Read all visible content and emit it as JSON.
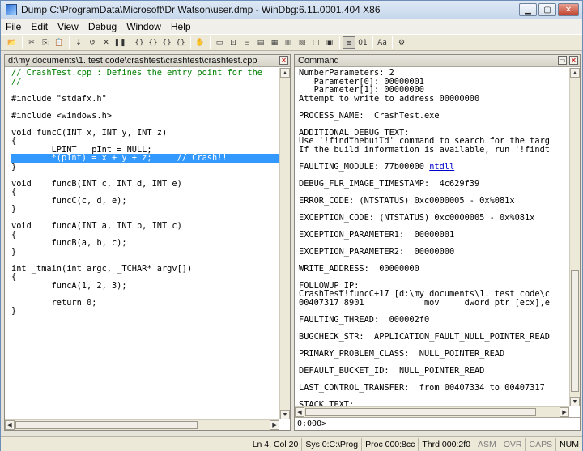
{
  "window": {
    "title": "Dump C:\\ProgramData\\Microsoft\\Dr Watson\\user.dmp - WinDbg:6.11.0001.404 X86"
  },
  "menu": [
    "File",
    "Edit",
    "View",
    "Debug",
    "Window",
    "Help"
  ],
  "toolbar": {
    "buttons": [
      {
        "name": "open-icon",
        "glyph": "📂"
      },
      {
        "sep": true
      },
      {
        "name": "cut-icon",
        "glyph": "✂"
      },
      {
        "name": "copy-icon",
        "glyph": "⎘"
      },
      {
        "name": "paste-icon",
        "glyph": "📋"
      },
      {
        "sep": true
      },
      {
        "name": "go-icon",
        "glyph": "⇣"
      },
      {
        "name": "restart-icon",
        "glyph": "↺"
      },
      {
        "name": "stop-debugging-icon",
        "glyph": "✕"
      },
      {
        "name": "break-icon",
        "glyph": "❚❚"
      },
      {
        "sep": true
      },
      {
        "name": "step-into-icon",
        "glyph": "{}"
      },
      {
        "name": "step-over-icon",
        "glyph": "{}"
      },
      {
        "name": "step-out-icon",
        "glyph": "{}"
      },
      {
        "name": "run-to-cursor-icon",
        "glyph": "{}"
      },
      {
        "sep": true
      },
      {
        "name": "breakpoint-icon",
        "glyph": "✋"
      },
      {
        "sep": true
      },
      {
        "name": "command-window-icon",
        "glyph": "▭"
      },
      {
        "name": "watch-window-icon",
        "glyph": "⊡"
      },
      {
        "name": "locals-window-icon",
        "glyph": "⊟"
      },
      {
        "name": "registers-window-icon",
        "glyph": "▤"
      },
      {
        "name": "memory-window-icon",
        "glyph": "▦"
      },
      {
        "name": "call-stack-window-icon",
        "glyph": "▥"
      },
      {
        "name": "disassembly-window-icon",
        "glyph": "▧"
      },
      {
        "name": "scratch-pad-icon",
        "glyph": "▢"
      },
      {
        "name": "processes-threads-icon",
        "glyph": "▣"
      },
      {
        "sep": true
      },
      {
        "name": "source-mode-icon",
        "glyph": "≣",
        "pressed": true
      },
      {
        "name": "hex-display-icon",
        "glyph": "01"
      },
      {
        "sep": true
      },
      {
        "name": "font-icon",
        "glyph": "Aa"
      },
      {
        "sep": true
      },
      {
        "name": "options-icon",
        "glyph": "⚙"
      }
    ]
  },
  "source_pane": {
    "title": "d:\\my documents\\1. test code\\crashtest\\crashtest\\crashtest.cpp",
    "lines": [
      {
        "text": "// CrashTest.cpp : Defines the entry point for the",
        "kind": "comment"
      },
      {
        "text": "//",
        "kind": "comment"
      },
      {
        "text": "",
        "kind": "plain"
      },
      {
        "text": "#include \"stdafx.h\"",
        "kind": "include-cursor"
      },
      {
        "text": "",
        "kind": "plain"
      },
      {
        "text": "#include <windows.h>",
        "kind": "plain"
      },
      {
        "text": "",
        "kind": "plain"
      },
      {
        "text": "void funcC(INT x, INT y, INT z)",
        "kind": "plain"
      },
      {
        "text": "{",
        "kind": "plain"
      },
      {
        "text": "        LPINT   pInt = NULL;",
        "kind": "plain"
      },
      {
        "text": "        *(pInt) = x + y + z;     // Crash!!",
        "kind": "highlight"
      },
      {
        "text": "}",
        "kind": "plain"
      },
      {
        "text": "",
        "kind": "plain"
      },
      {
        "text": "void    funcB(INT c, INT d, INT e)",
        "kind": "plain"
      },
      {
        "text": "{",
        "kind": "plain"
      },
      {
        "text": "        funcC(c, d, e);",
        "kind": "plain"
      },
      {
        "text": "}",
        "kind": "plain"
      },
      {
        "text": "",
        "kind": "plain"
      },
      {
        "text": "void    funcA(INT a, INT b, INT c)",
        "kind": "plain"
      },
      {
        "text": "{",
        "kind": "plain"
      },
      {
        "text": "        funcB(a, b, c);",
        "kind": "plain"
      },
      {
        "text": "}",
        "kind": "plain"
      },
      {
        "text": "",
        "kind": "plain"
      },
      {
        "text": "int _tmain(int argc, _TCHAR* argv[])",
        "kind": "plain"
      },
      {
        "text": "{",
        "kind": "plain"
      },
      {
        "text": "        funcA(1, 2, 3);",
        "kind": "plain"
      },
      {
        "text": "",
        "kind": "plain"
      },
      {
        "text": "        return 0;",
        "kind": "plain"
      },
      {
        "text": "}",
        "kind": "plain"
      }
    ]
  },
  "command_pane": {
    "title": "Command",
    "lines": [
      {
        "text": "NumberParameters: 2"
      },
      {
        "text": "   Parameter[0]: 00000001"
      },
      {
        "text": "   Parameter[1]: 00000000"
      },
      {
        "text": "Attempt to write to address 00000000"
      },
      {
        "text": ""
      },
      {
        "text": "PROCESS_NAME:  CrashTest.exe"
      },
      {
        "text": ""
      },
      {
        "text": "ADDITIONAL_DEBUG_TEXT:"
      },
      {
        "text": "Use '!findthebuild' command to search for the targ"
      },
      {
        "text": "If the build information is available, run '!findt"
      },
      {
        "text": ""
      },
      {
        "text": "FAULTING_MODULE: 77b00000 ",
        "link": "ntdll"
      },
      {
        "text": ""
      },
      {
        "text": "DEBUG_FLR_IMAGE_TIMESTAMP:  4c629f39"
      },
      {
        "text": ""
      },
      {
        "text": "ERROR_CODE: (NTSTATUS) 0xc0000005 - 0x%081x"
      },
      {
        "text": ""
      },
      {
        "text": "EXCEPTION_CODE: (NTSTATUS) 0xc0000005 - 0x%081x"
      },
      {
        "text": ""
      },
      {
        "text": "EXCEPTION_PARAMETER1:  00000001"
      },
      {
        "text": ""
      },
      {
        "text": "EXCEPTION_PARAMETER2:  00000000"
      },
      {
        "text": ""
      },
      {
        "text": "WRITE_ADDRESS:  00000000"
      },
      {
        "text": ""
      },
      {
        "text": "FOLLOWUP_IP:"
      },
      {
        "text": "CrashTest!funcC+17 [d:\\my documents\\1. test code\\c"
      },
      {
        "text": "00407317 8901            mov     dword ptr [ecx],e"
      },
      {
        "text": ""
      },
      {
        "text": "FAULTING_THREAD:  000002f0"
      },
      {
        "text": ""
      },
      {
        "text": "BUGCHECK_STR:  APPLICATION_FAULT_NULL_POINTER_READ"
      },
      {
        "text": ""
      },
      {
        "text": "PRIMARY_PROBLEM_CLASS:  NULL_POINTER_READ"
      },
      {
        "text": ""
      },
      {
        "text": "DEFAULT_BUCKET_ID:  NULL_POINTER_READ"
      },
      {
        "text": ""
      },
      {
        "text": "LAST_CONTROL_TRANSFER:  from 00407334 to 00407317"
      },
      {
        "text": ""
      },
      {
        "text": "STACK_TEXT:"
      }
    ],
    "prompt": "0:000>",
    "input_value": ""
  },
  "status": {
    "position": "Ln 4, Col 20",
    "system": "Sys 0:C:\\Prog",
    "process": "Proc 000:8cc",
    "thread": "Thrd 000:2f0",
    "asm": "ASM",
    "ovr": "OVR",
    "caps": "CAPS",
    "num": "NUM"
  }
}
